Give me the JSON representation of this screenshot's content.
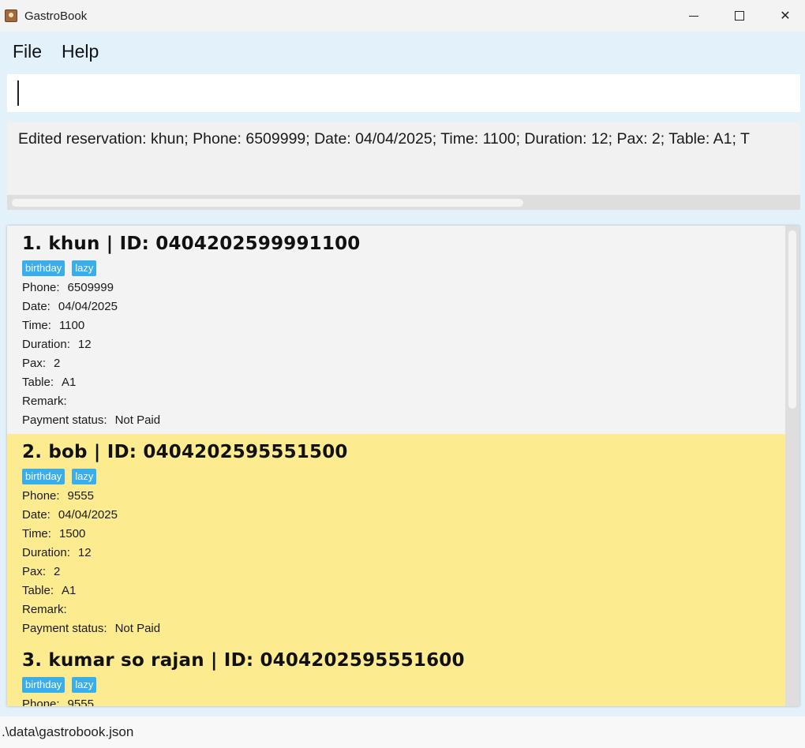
{
  "window": {
    "title": "GastroBook",
    "minimize_glyph": "",
    "maximize_glyph": "",
    "close_glyph": "✕"
  },
  "menu": {
    "file": "File",
    "help": "Help"
  },
  "command": {
    "value": ""
  },
  "result": {
    "text": "Edited reservation: khun; Phone: 6509999; Date: 04/04/2025; Time: 1100; Duration: 12; Pax: 2; Table: A1; T"
  },
  "labels": {
    "phone": "Phone:",
    "date": "Date:",
    "time": "Time:",
    "duration": "Duration:",
    "pax": "Pax:",
    "table": "Table:",
    "remark": "Remark:",
    "payment": "Payment status:"
  },
  "reservations": [
    {
      "title": "1. khun | ID: 0404202599991100",
      "tags": [
        "birthday",
        "lazy"
      ],
      "phone": "6509999",
      "date": "04/04/2025",
      "time": "1100",
      "duration": "12",
      "pax": "2",
      "table": "A1",
      "remark": "",
      "payment": "Not Paid",
      "selected": false
    },
    {
      "title": "2. bob | ID: 0404202595551500",
      "tags": [
        "birthday",
        "lazy"
      ],
      "phone": "9555",
      "date": "04/04/2025",
      "time": "1500",
      "duration": "12",
      "pax": "2",
      "table": "A1",
      "remark": "",
      "payment": "Not Paid",
      "selected": true
    },
    {
      "title": "3. kumar so rajan | ID: 0404202595551600",
      "tags": [
        "birthday",
        "lazy"
      ],
      "phone": "9555"
    }
  ],
  "status": {
    "path": ".\\data\\gastrobook.json"
  },
  "colors": {
    "menu_bg": "#e3f1fb",
    "selected_card": "#fdec8f",
    "tag": "#3aaeea"
  }
}
